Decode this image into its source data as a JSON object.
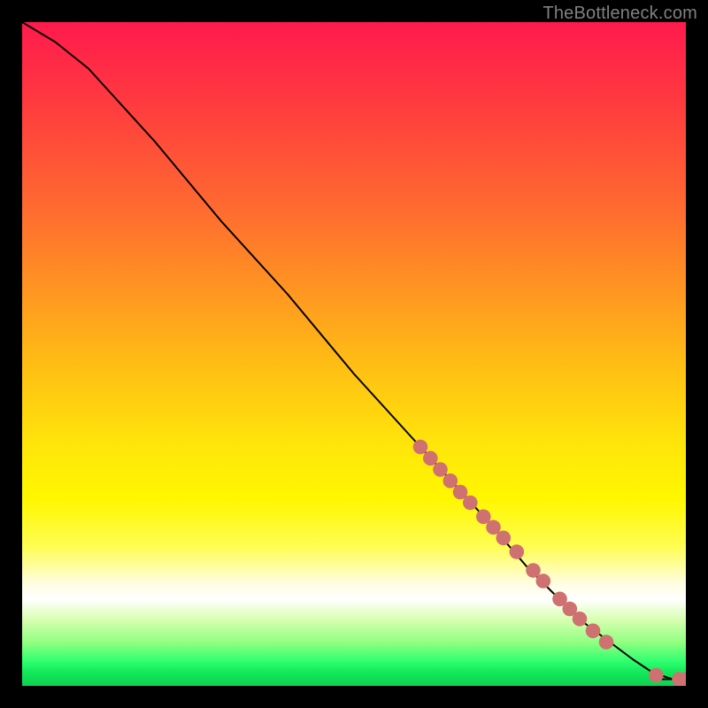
{
  "attribution": "TheBottleneck.com",
  "chart_data": {
    "type": "line",
    "title": "",
    "xlabel": "",
    "ylabel": "",
    "xlim": [
      0,
      100
    ],
    "ylim": [
      0,
      100
    ],
    "grid": false,
    "legend": false,
    "series": [
      {
        "name": "curve",
        "x": [
          0,
          5,
          10,
          20,
          30,
          40,
          50,
          60,
          70,
          76,
          80,
          84,
          88,
          92,
          95,
          98,
          100
        ],
        "y": [
          100,
          97,
          93,
          82,
          70,
          59,
          47,
          36,
          25,
          18,
          14,
          10,
          7,
          4,
          2,
          1,
          1
        ]
      }
    ],
    "markers": [
      {
        "x": 60.0,
        "y": 36.0
      },
      {
        "x": 61.5,
        "y": 34.3
      },
      {
        "x": 63.0,
        "y": 32.6
      },
      {
        "x": 64.5,
        "y": 30.9
      },
      {
        "x": 66.0,
        "y": 29.2
      },
      {
        "x": 67.5,
        "y": 27.6
      },
      {
        "x": 69.5,
        "y": 25.5
      },
      {
        "x": 71.0,
        "y": 23.9
      },
      {
        "x": 72.5,
        "y": 22.3
      },
      {
        "x": 74.5,
        "y": 20.2
      },
      {
        "x": 77.0,
        "y": 17.4
      },
      {
        "x": 78.5,
        "y": 15.8
      },
      {
        "x": 81.0,
        "y": 13.1
      },
      {
        "x": 82.5,
        "y": 11.6
      },
      {
        "x": 84.0,
        "y": 10.1
      },
      {
        "x": 86.0,
        "y": 8.3
      },
      {
        "x": 88.0,
        "y": 6.6
      },
      {
        "x": 95.5,
        "y": 1.6
      },
      {
        "x": 99.0,
        "y": 1.0
      },
      {
        "x": 100.0,
        "y": 1.0
      }
    ],
    "marker_radius_pct": 1.1,
    "background_gradient": {
      "type": "vertical",
      "stops": [
        {
          "pos": 0.0,
          "color": "#ff1a4d"
        },
        {
          "pos": 0.4,
          "color": "#ff9422"
        },
        {
          "pos": 0.72,
          "color": "#fff700"
        },
        {
          "pos": 0.87,
          "color": "#ffffff"
        },
        {
          "pos": 1.0,
          "color": "#0fd052"
        }
      ]
    }
  }
}
